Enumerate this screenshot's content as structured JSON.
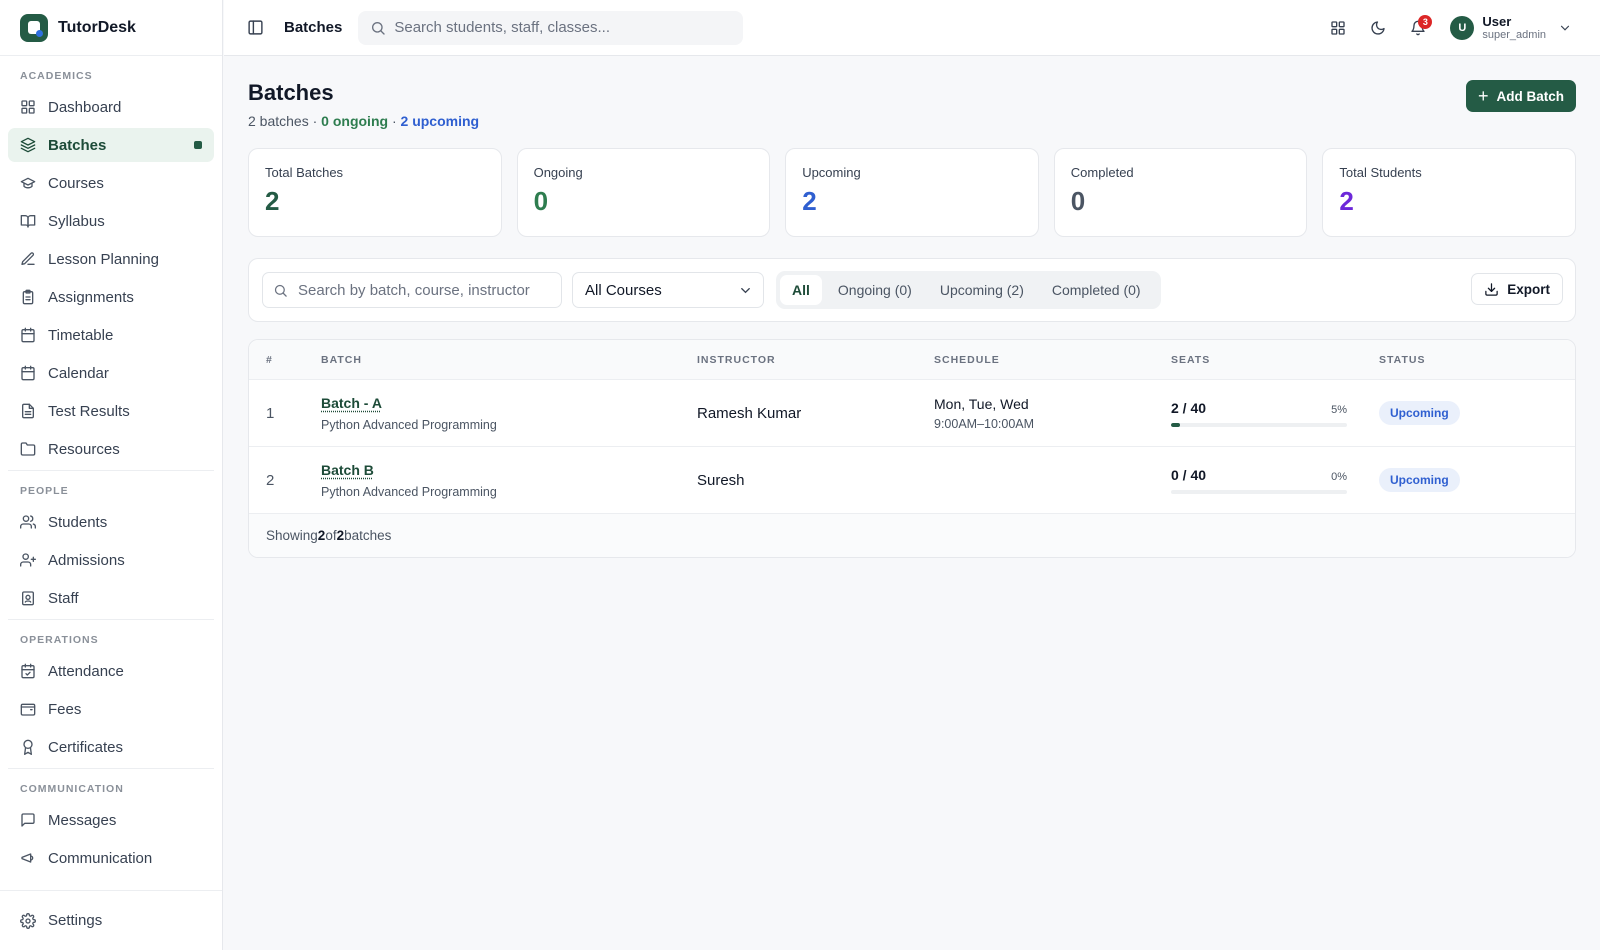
{
  "app": {
    "name": "TutorDesk"
  },
  "sidebar": {
    "sections": [
      {
        "heading": "ACADEMICS",
        "items": [
          {
            "label": "Dashboard",
            "icon": "grid-icon"
          },
          {
            "label": "Batches",
            "icon": "layers-icon",
            "active": true
          },
          {
            "label": "Courses",
            "icon": "graduation-cap-icon"
          },
          {
            "label": "Syllabus",
            "icon": "book-open-icon"
          },
          {
            "label": "Lesson Planning",
            "icon": "edit-note-icon"
          },
          {
            "label": "Assignments",
            "icon": "clipboard-icon"
          },
          {
            "label": "Timetable",
            "icon": "calendar-icon"
          },
          {
            "label": "Calendar",
            "icon": "calendar-icon"
          },
          {
            "label": "Test Results",
            "icon": "file-text-icon"
          },
          {
            "label": "Resources",
            "icon": "folder-icon"
          }
        ]
      },
      {
        "heading": "PEOPLE",
        "items": [
          {
            "label": "Students",
            "icon": "users-icon"
          },
          {
            "label": "Admissions",
            "icon": "user-plus-icon"
          },
          {
            "label": "Staff",
            "icon": "id-badge-icon"
          }
        ]
      },
      {
        "heading": "OPERATIONS",
        "items": [
          {
            "label": "Attendance",
            "icon": "calendar-check-icon"
          },
          {
            "label": "Fees",
            "icon": "wallet-icon"
          },
          {
            "label": "Certificates",
            "icon": "award-icon"
          }
        ]
      },
      {
        "heading": "COMMUNICATION",
        "items": [
          {
            "label": "Messages",
            "icon": "message-icon"
          },
          {
            "label": "Communication",
            "icon": "megaphone-icon"
          }
        ]
      }
    ],
    "footer": {
      "label": "Settings",
      "icon": "gear-icon"
    }
  },
  "topbar": {
    "title": "Batches",
    "search_placeholder": "Search students, staff, classes...",
    "notifications_count": "3",
    "user": {
      "initial": "U",
      "name": "User",
      "role": "super_admin"
    }
  },
  "page": {
    "title": "Batches",
    "subtitle": {
      "total": "2 batches",
      "sep1": " · ",
      "ongoing": "0 ongoing",
      "sep2": " · ",
      "upcoming": "2 upcoming"
    },
    "add_button": "Add Batch"
  },
  "stats": [
    {
      "label": "Total Batches",
      "value": "2",
      "color": "#245b45"
    },
    {
      "label": "Ongoing",
      "value": "0",
      "color": "#2e7d4f"
    },
    {
      "label": "Upcoming",
      "value": "2",
      "color": "#2f5fd0"
    },
    {
      "label": "Completed",
      "value": "0",
      "color": "#4b5563"
    },
    {
      "label": "Total Students",
      "value": "2",
      "color": "#6d28d9"
    }
  ],
  "filters": {
    "search_placeholder": "Search by batch, course, instructor",
    "course_select": "All Courses",
    "tabs": [
      "All",
      "Ongoing (0)",
      "Upcoming (2)",
      "Completed (0)"
    ],
    "active_tab": 0,
    "export_label": "Export"
  },
  "table": {
    "columns": [
      "#",
      "BATCH",
      "INSTRUCTOR",
      "SCHEDULE",
      "SEATS",
      "STATUS"
    ],
    "rows": [
      {
        "num": "1",
        "batch": "Batch - A",
        "course": "Python Advanced Programming",
        "instructor": "Ramesh Kumar",
        "days": "Mon, Tue, Wed",
        "time": "9:00AM–10:00AM",
        "seats": "2 / 40",
        "pct": "5%",
        "fill": 5,
        "status": "Upcoming"
      },
      {
        "num": "2",
        "batch": "Batch B",
        "course": "Python Advanced Programming",
        "instructor": "Suresh",
        "days": "",
        "time": "",
        "seats": "0 / 40",
        "pct": "0%",
        "fill": 0,
        "status": "Upcoming"
      }
    ],
    "footer": {
      "prefix": "Showing ",
      "shown": "2",
      "mid": " of ",
      "total": "2",
      "suffix": " batches"
    }
  },
  "colors": {
    "brand": "#245b45",
    "ongoing": "#2e7d4f",
    "upcoming": "#2f5fd0",
    "students": "#6d28d9"
  }
}
